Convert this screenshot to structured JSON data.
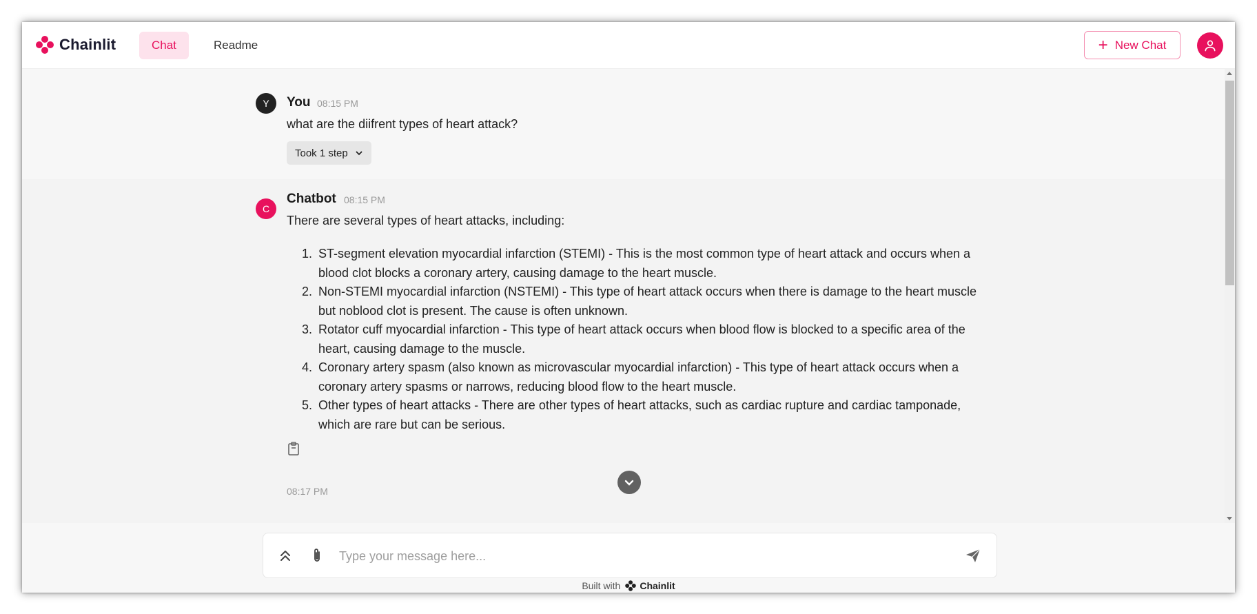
{
  "header": {
    "brand": "Chainlit",
    "nav": [
      {
        "label": "Chat",
        "active": true
      },
      {
        "label": "Readme",
        "active": false
      }
    ],
    "new_chat_label": "New Chat"
  },
  "messages": {
    "user": {
      "avatar_letter": "Y",
      "author": "You",
      "time": "08:15 PM",
      "text": "what are the diifrent types of heart attack?",
      "steps_label": "Took 1 step"
    },
    "bot": {
      "avatar_letter": "C",
      "author": "Chatbot",
      "time": "08:15 PM",
      "intro": "There are several types of heart attacks, including:",
      "items": [
        {
          "num": "1.",
          "text": "ST-segment elevation myocardial infarction (STEMI) - This is the most common type of heart attack and occurs when a blood clot blocks a coronary artery, causing damage to the heart muscle."
        },
        {
          "num": "2.",
          "text": "Non-STEMI myocardial infarction (NSTEMI) - This type of heart attack occurs when there is damage to the heart muscle but noblood clot is present. The cause is often unknown."
        },
        {
          "num": "3.",
          "text": "Rotator cuff myocardial infarction - This type of heart attack occurs when blood flow is blocked to a specific area of the heart, causing damage to the muscle."
        },
        {
          "num": "4.",
          "text": "Coronary artery spasm (also known as microvascular myocardial infarction) - This type of heart attack occurs when a coronary artery spasms or narrows, reducing blood flow to the heart muscle."
        },
        {
          "num": "5.",
          "text": "Other types of heart attacks - There are other types of heart attacks, such as cardiac rupture and cardiac tamponade, which are rare but can be serious."
        }
      ]
    },
    "next_time": "08:17 PM"
  },
  "composer": {
    "placeholder": "Type your message here...",
    "value": ""
  },
  "footer": {
    "built_with": "Built with",
    "brand": "Chainlit"
  },
  "colors": {
    "accent": "#e8115d",
    "accent_light": "#fde2ec"
  },
  "icons": [
    "chainlit-logo-icon",
    "plus-icon",
    "user-icon",
    "chevron-down-icon",
    "clipboard-icon",
    "settings-chevrons-icon",
    "paperclip-icon",
    "send-icon"
  ]
}
